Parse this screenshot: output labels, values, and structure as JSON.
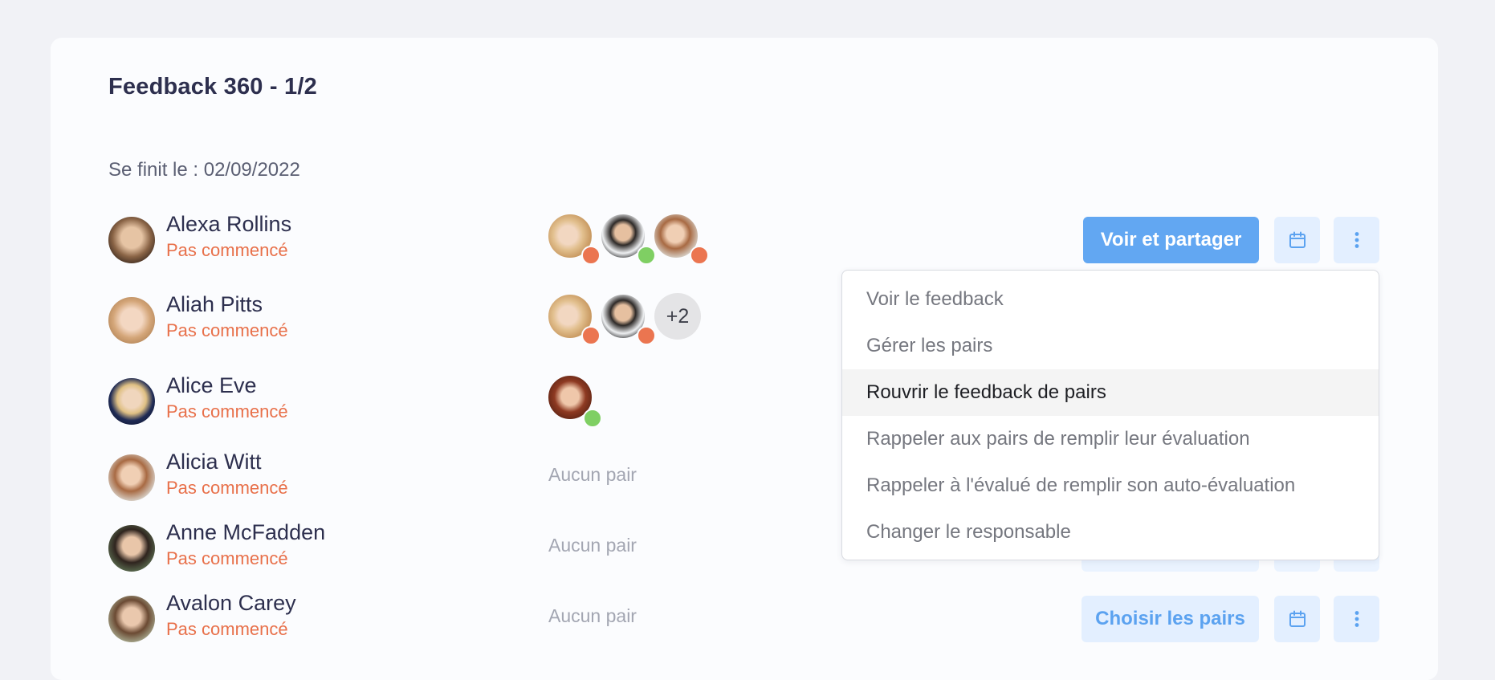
{
  "page": {
    "title": "Feedback 360 - 1/2",
    "end_date": "Se finit le : 02/09/2022"
  },
  "rows": [
    {
      "name": "Alexa Rollins",
      "status": "Pas commencé",
      "peers_more": "",
      "no_peers": "",
      "action": "Voir et partager"
    },
    {
      "name": "Aliah Pitts",
      "status": "Pas commencé",
      "peers_more": "+2",
      "no_peers": "",
      "action": ""
    },
    {
      "name": "Alice Eve",
      "status": "Pas commencé",
      "peers_more": "",
      "no_peers": "",
      "action": ""
    },
    {
      "name": "Alicia Witt",
      "status": "Pas commencé",
      "peers_more": "",
      "no_peers": "Aucun pair",
      "action": ""
    },
    {
      "name": "Anne McFadden",
      "status": "Pas commencé",
      "peers_more": "",
      "no_peers": "Aucun pair",
      "action": ""
    },
    {
      "name": "Avalon Carey",
      "status": "Pas commencé",
      "peers_more": "",
      "no_peers": "Aucun pair",
      "action": "Choisir les pairs"
    }
  ],
  "dropdown": {
    "items": [
      {
        "label": "Voir le feedback",
        "active": false
      },
      {
        "label": "Gérer les pairs",
        "active": false
      },
      {
        "label": "Rouvrir le feedback de pairs",
        "active": true
      },
      {
        "label": "Rappeler aux pairs de remplir leur évaluation",
        "active": false
      },
      {
        "label": "Rappeler à l'évalué de remplir son auto-évaluation",
        "active": false
      },
      {
        "label": "Changer le responsable",
        "active": false
      }
    ]
  },
  "icons": {
    "calendar": "calendar-icon",
    "more": "more-vertical-icon"
  },
  "colors": {
    "primary": "#62a7f2",
    "primary_light": "#e3efff",
    "status_not_started": "#e8704a",
    "peer_done": "#7fcf63",
    "peer_pending": "#eb7550"
  }
}
